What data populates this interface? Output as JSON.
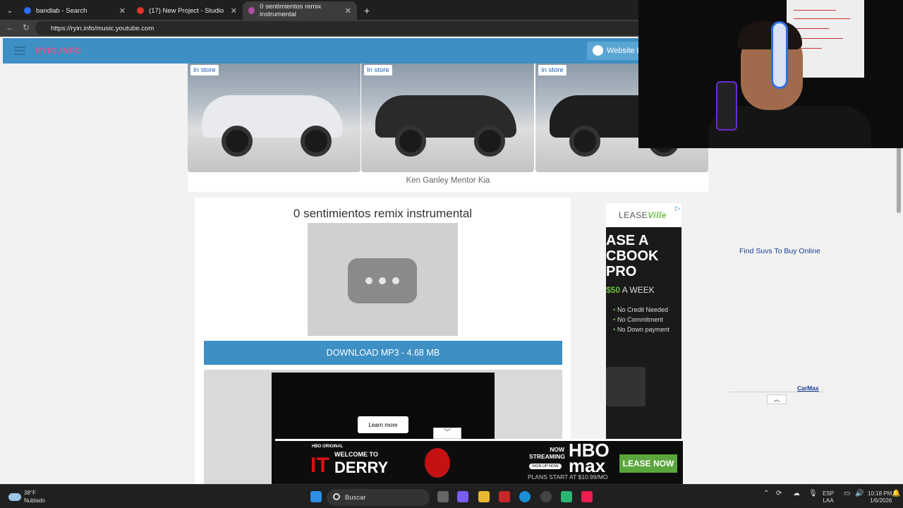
{
  "browser": {
    "tabs": [
      {
        "title": "bandlab - Search",
        "active": false
      },
      {
        "title": "(17) New Project - Studio",
        "active": false
      },
      {
        "title": "0 sentimientos remix instrumental",
        "active": true
      }
    ],
    "url": "https://ryin.info/music.youtube.com"
  },
  "site": {
    "logo": "RYIO.INFO",
    "website_button": "Website L"
  },
  "car_ad": {
    "badges": [
      "In store",
      "In store",
      "In store"
    ],
    "dealer": "Ken Ganley Mentor Kia"
  },
  "main": {
    "title": "0 sentimientos remix instrumental",
    "download_label": "DOWNLOAD MP3 - 4.68 MB",
    "learn_more": "Learn more"
  },
  "side_ad": {
    "brand_a": "LEASE",
    "brand_b": "Ville",
    "headline1": "ASE A",
    "headline2": "CBOOK",
    "headline3": "PRO",
    "price": "$50",
    "per": "A WEEK",
    "bullets": [
      "No Credit Needed",
      "No Commitment",
      "No Down payment"
    ],
    "link": "Find Suvs To Buy Online",
    "carmax": "CarMax"
  },
  "bottom_ad": {
    "hbo_original": "HBO ORIGINAL",
    "it": "IT",
    "welcome": "WELCOME TO",
    "derry": "DERRY",
    "streaming": "NOW STREAMING",
    "signup": "SIGN UP NOW",
    "hbomax": "HBO max",
    "plans": "PLANS START AT $10.99/MO",
    "lease_now": "LEASE NOW"
  },
  "taskbar": {
    "temp": "38°F",
    "condition": "Nublado",
    "search": "Buscar",
    "lang1": "ESP",
    "lang2": "LAA",
    "time": "10:18 PM",
    "date": "1/6/2026"
  }
}
